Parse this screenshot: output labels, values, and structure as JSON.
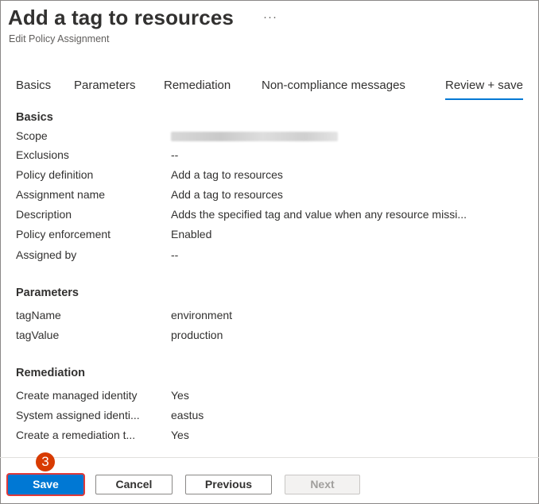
{
  "header": {
    "title": "Add a tag to resources",
    "more_label": "···",
    "subtitle": "Edit Policy Assignment"
  },
  "tabs": [
    {
      "label": "Basics",
      "active": false
    },
    {
      "label": "Parameters",
      "active": false
    },
    {
      "label": "Remediation",
      "active": false
    },
    {
      "label": "Non-compliance messages",
      "active": false
    },
    {
      "label": "Review + save",
      "active": true
    }
  ],
  "basics": {
    "title": "Basics",
    "rows": [
      {
        "label": "Scope",
        "value": ""
      },
      {
        "label": "Exclusions",
        "value": "--"
      },
      {
        "label": "Policy definition",
        "value": "Add a tag to resources"
      },
      {
        "label": "Assignment name",
        "value": "Add a tag to resources"
      },
      {
        "label": "Description",
        "value": "Adds the specified tag and value when any resource missi..."
      },
      {
        "label": "Policy enforcement",
        "value": "Enabled"
      },
      {
        "label": "Assigned by",
        "value": "--"
      }
    ]
  },
  "parameters": {
    "title": "Parameters",
    "rows": [
      {
        "label": "tagName",
        "value": "environment"
      },
      {
        "label": "tagValue",
        "value": "production"
      }
    ]
  },
  "remediation": {
    "title": "Remediation",
    "rows": [
      {
        "label": "Create managed identity",
        "value": "Yes"
      },
      {
        "label": "System assigned identi...",
        "value": "eastus"
      },
      {
        "label": "Create a remediation t...",
        "value": "Yes"
      }
    ]
  },
  "footer": {
    "step_badge": "3",
    "save_label": "Save",
    "cancel_label": "Cancel",
    "previous_label": "Previous",
    "next_label": "Next"
  },
  "colors": {
    "accent": "#0078d4",
    "highlight": "#e03a3a",
    "badge": "#d83b01"
  }
}
